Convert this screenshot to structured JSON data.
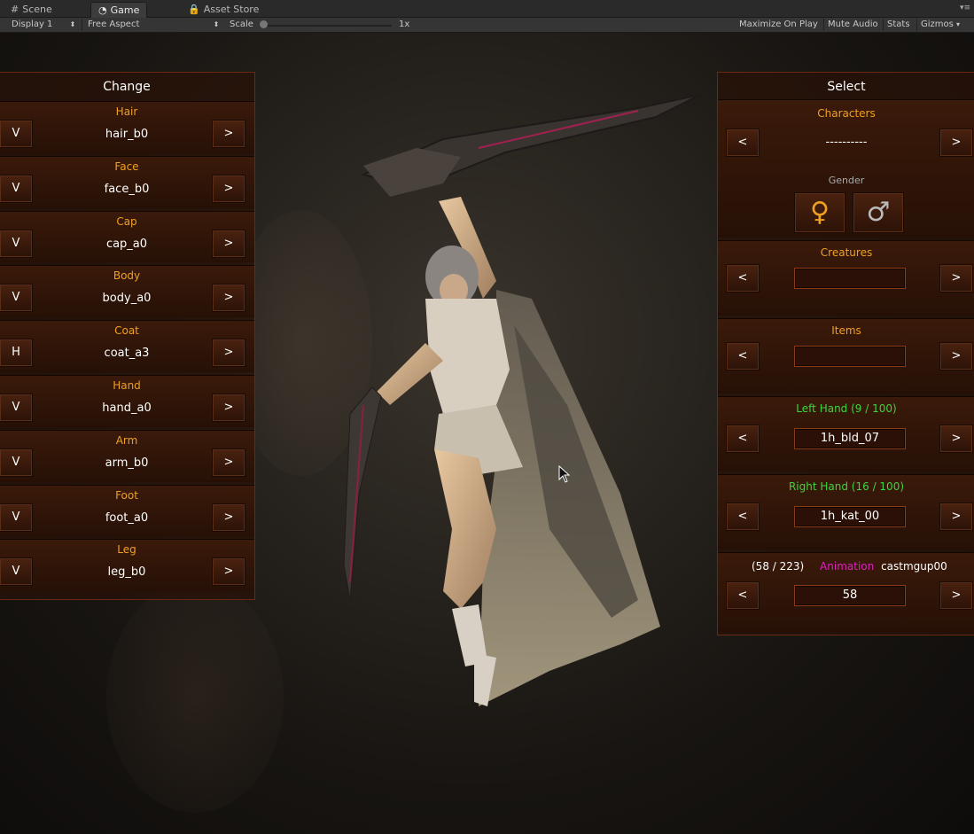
{
  "tabs": [
    {
      "label": "Scene",
      "icon": "grid-icon"
    },
    {
      "label": "Game",
      "icon": "pacman-icon"
    },
    {
      "label": "Asset Store",
      "icon": "lock-icon"
    }
  ],
  "toolbar": {
    "display": "Display 1",
    "aspect": "Free Aspect",
    "scale_label": "Scale",
    "scale_value": "1x",
    "maximize": "Maximize On Play",
    "mute": "Mute Audio",
    "stats": "Stats",
    "gizmos": "Gizmos"
  },
  "change_panel": {
    "title": "Change",
    "rows": [
      {
        "label": "Hair",
        "toggle": "V",
        "value": "hair_b0",
        "next": ">"
      },
      {
        "label": "Face",
        "toggle": "V",
        "value": "face_b0",
        "next": ">"
      },
      {
        "label": "Cap",
        "toggle": "V",
        "value": "cap_a0",
        "next": ">"
      },
      {
        "label": "Body",
        "toggle": "V",
        "value": "body_a0",
        "next": ">"
      },
      {
        "label": "Coat",
        "toggle": "H",
        "value": "coat_a3",
        "next": ">"
      },
      {
        "label": "Hand",
        "toggle": "V",
        "value": "hand_a0",
        "next": ">"
      },
      {
        "label": "Arm",
        "toggle": "V",
        "value": "arm_b0",
        "next": ">"
      },
      {
        "label": "Foot",
        "toggle": "V",
        "value": "foot_a0",
        "next": ">"
      },
      {
        "label": "Leg",
        "toggle": "V",
        "value": "leg_b0",
        "next": ">"
      }
    ]
  },
  "select_panel": {
    "title": "Select",
    "characters": {
      "label": "Characters",
      "value": "----------",
      "prev": "<",
      "next": ">"
    },
    "gender": {
      "label": "Gender",
      "female": "♀",
      "male": "♂"
    },
    "creatures": {
      "label": "Creatures",
      "value": "",
      "prev": "<",
      "next": ">"
    },
    "items": {
      "label": "Items",
      "value": "",
      "prev": "<",
      "next": ">"
    },
    "left_hand": {
      "label": "Left Hand (9 / 100)",
      "value": "1h_bld_07",
      "prev": "<",
      "next": ">"
    },
    "right_hand": {
      "label": "Right Hand (16 / 100)",
      "value": "1h_kat_00",
      "prev": "<",
      "next": ">"
    },
    "animation": {
      "count": "(58 / 223)",
      "label": "Animation",
      "name": "castmgup00",
      "value": "58",
      "prev": "<",
      "next": ">"
    }
  },
  "colors": {
    "accent_orange": "#f0a020",
    "green": "#3fd43f",
    "magenta": "#e020c0",
    "panel_border": "#6a2a10"
  }
}
